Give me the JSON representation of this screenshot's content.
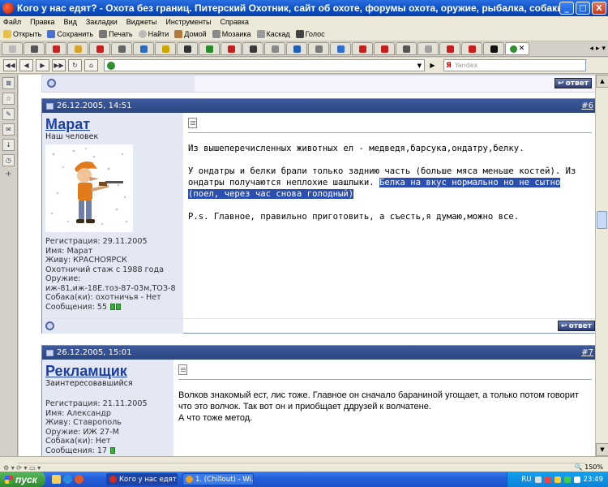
{
  "window": {
    "title": "Кого у нас едят? - Охота без границ. Питерский Охотник, сайт об охоте, форумы охота, оружие, рыбалка, собаки, патроны...",
    "minimize": "_",
    "maximize": "□",
    "close": "X"
  },
  "menu": [
    "Файл",
    "Правка",
    "Вид",
    "Закладки",
    "Виджеты",
    "Инструменты",
    "Справка"
  ],
  "toolbar": [
    "Открыть",
    "Сохранить",
    "Печать",
    "Найти",
    "Домой",
    "Мозаика",
    "Каскад",
    "Голос"
  ],
  "tabs": {
    "favicon_colors": [
      "#b9b9b9",
      "#555555",
      "#cc2222",
      "#d6a32c",
      "#c81e1e",
      "#666666",
      "#2a6bc4",
      "#c9a600",
      "#333333",
      "#2a8a2a",
      "#c81e1e",
      "#3a3a3a",
      "#888888",
      "#1f5fb5",
      "#7a7a7a",
      "#2f6fce",
      "#c81e1e",
      "#c81e1e",
      "#555555",
      "#a0a0a0",
      "#c81e1e",
      "#c81e1e",
      "#111111"
    ],
    "active_label": "✕"
  },
  "search": {
    "placeholder": "Yandex"
  },
  "posts": [
    {
      "date": "26.12.2005, 14:51",
      "number": "#6",
      "user": "Марат",
      "rank": "Наш человек",
      "info": [
        "Регистрация: 29.11.2005",
        "Имя: Марат",
        "Живу: КРАСНОЯРСК",
        "Охотничий стаж с 1988 года",
        "Оружие:",
        "иж-81,иж-18Е.тоз-87-03м,ТОЗ-8",
        "Собака(ки): охотничья - Нет"
      ],
      "messages_label": "Сообщения: 55",
      "text1": "Из вышеперечисленных животных ел - медведя,барсука,ондатру,белку.",
      "text2a": "У ондатры и белки брали только заднию часть (больше мяса меньше костей). Из ондатры получаются неплохие шашлыки. ",
      "text2sel": "Белка на вкус нормально но не сытно (поел, через час снова голодный)",
      "text3": "P.s. Главное, правильно приготовить, а съесть,я думаю,можно все.",
      "reply": "ответ"
    },
    {
      "date": "26.12.2005, 15:01",
      "number": "#7",
      "user": "Рекламщик",
      "rank": "Заинтересовавшийся",
      "info": [
        "Регистрация: 21.11.2005",
        "Имя: Александр",
        "Живу: Ставрополь",
        "Оружие: ИЖ 27-М",
        "Собака(ки): Нет"
      ],
      "messages_label": "Сообщения: 17",
      "text1": "Волков знакомый ест, лис тоже. Главное он сначало бараниной угощает, а только потом говорит что это волчок. Так вот он и приобщает ддрузей к волчатене.",
      "text2": "А что тоже метод."
    }
  ],
  "tail_reply": "ответ",
  "status": {
    "zoom": "150%"
  },
  "taskbar": {
    "start": "пуск",
    "tasks": [
      "Кого у нас едят? ...",
      "1. (Chillout) - Wi..."
    ],
    "lang": "RU",
    "time": "23:49"
  }
}
